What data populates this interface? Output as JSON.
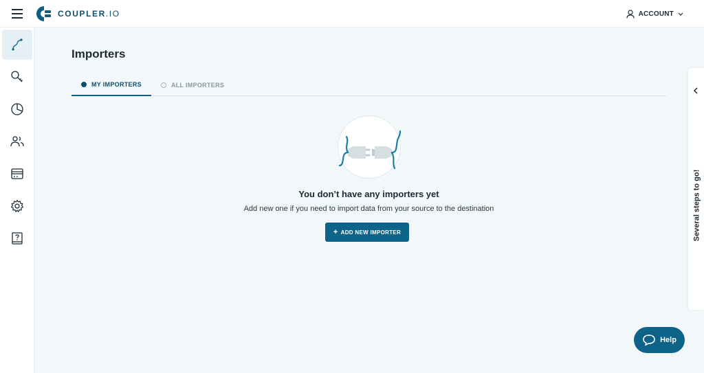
{
  "header": {
    "logo_brand": "COUPLER",
    "logo_suffix": ".IO",
    "account_label": "ACCOUNT"
  },
  "sidebar": {
    "items": [
      {
        "name": "importers",
        "icon": "flow-path-icon",
        "active": true
      },
      {
        "name": "search",
        "icon": "key-search-icon",
        "active": false
      },
      {
        "name": "reports",
        "icon": "pie-chart-icon",
        "active": false
      },
      {
        "name": "team",
        "icon": "users-icon",
        "active": false
      },
      {
        "name": "billing",
        "icon": "card-icon",
        "active": false
      },
      {
        "name": "settings",
        "icon": "gear-icon",
        "active": false
      },
      {
        "name": "help-center",
        "icon": "help-book-icon",
        "active": false
      }
    ]
  },
  "main": {
    "title": "Importers",
    "tabs": [
      {
        "label": "MY IMPORTERS",
        "active": true
      },
      {
        "label": "ALL IMPORTERS",
        "active": false
      }
    ],
    "empty_state": {
      "title": "You don’t have any importers yet",
      "subtitle": "Add new one if you need to import data from your source to the destination",
      "button_label": "ADD NEW IMPORTER",
      "illustration_icon": "plug-disconnected-icon"
    }
  },
  "steps_panel": {
    "label": "Several steps to go!"
  },
  "help": {
    "label": "Help"
  },
  "colors": {
    "brand": "#0d4f6e",
    "button": "#0d6488",
    "background": "#f2f7f9",
    "accent_wire": "#1a7fa3"
  }
}
